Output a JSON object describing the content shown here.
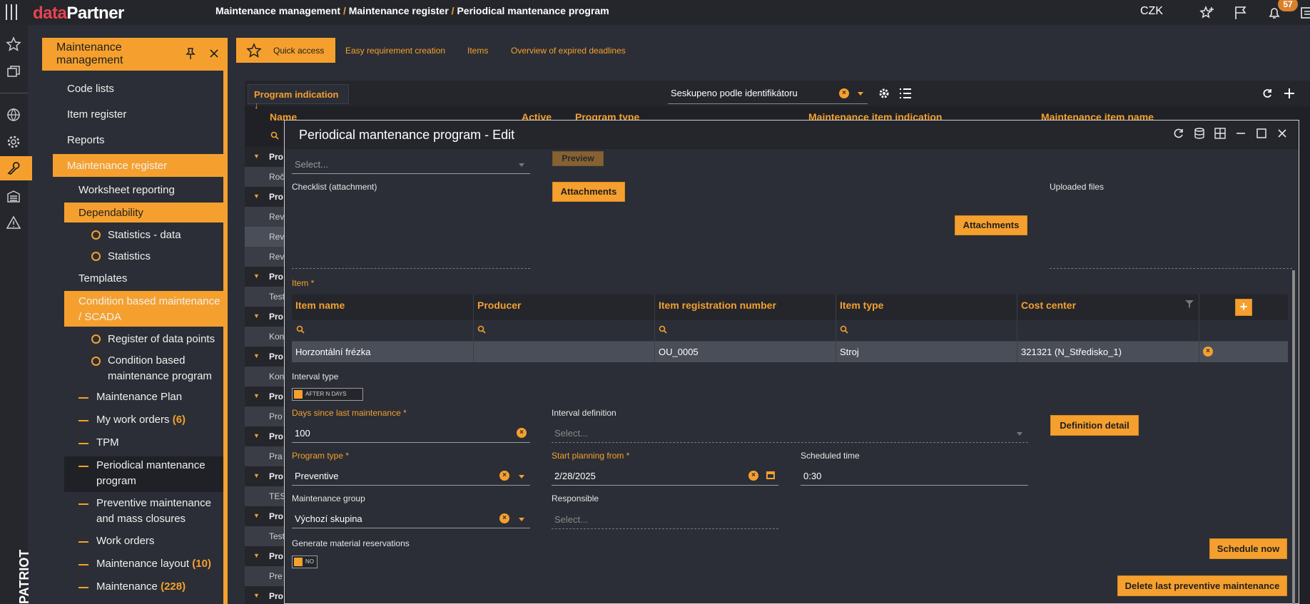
{
  "app": {
    "brand_a": "data",
    "brand_b": "Partner",
    "currency": "CZK",
    "notifications": "57",
    "breadcrumb": [
      "Maintenance management",
      "Maintenance register",
      "Periodical mantenance program"
    ],
    "vertical_brand": "PATRIOT"
  },
  "nav": {
    "title": "Maintenance management",
    "items": [
      {
        "label": "Code lists"
      },
      {
        "label": "Item register"
      },
      {
        "label": "Reports"
      },
      {
        "label": "Maintenance register"
      },
      {
        "label": "Worksheet reporting"
      },
      {
        "label": "Dependability"
      },
      {
        "label": "Statistics - data"
      },
      {
        "label": "Statistics"
      },
      {
        "label": "Templates"
      },
      {
        "label_1": "Condition based maintenance",
        "label_2": "/ SCADA"
      },
      {
        "label": "Register of data points"
      },
      {
        "label_1": "Condition based",
        "label_2": "maintenance program"
      },
      {
        "label": "Maintenance Plan"
      },
      {
        "label": "My work orders",
        "count": "(6)"
      },
      {
        "label": "TPM"
      },
      {
        "label_1": "Periodical mantenance",
        "label_2": "program"
      },
      {
        "label_1": "Preventive maintenance",
        "label_2": "and mass closures"
      },
      {
        "label": "Work orders"
      },
      {
        "label": "Maintenance layout",
        "count": "(10)"
      },
      {
        "label": "Maintenance",
        "count": "(228)"
      }
    ]
  },
  "tabs": [
    "Quick access",
    "Easy requirement creation",
    "Items",
    "Overview of expired deadlines"
  ],
  "grid": {
    "group_button": "Program indication",
    "group_select": "Seskupeno podle identifikátoru",
    "columns": [
      "Name",
      "Active",
      "Program type",
      "Maintenance item indication",
      "Maintenance item name"
    ],
    "rows": [
      "Pro",
      "Roč",
      "Pro",
      "Rev",
      "Rev",
      "Rev",
      "Pro",
      "Test",
      "Pro",
      "Kon",
      "Pro",
      "Kon",
      "Pro",
      "Pro",
      "Pro",
      "Pra",
      "Pro",
      "TES",
      "Pro",
      "Test",
      "Pro",
      "Pre",
      "Pro"
    ]
  },
  "modal": {
    "title": "Periodical mantenance program - Edit",
    "select_placeholder": "Select...",
    "preview_button": "Preview",
    "checklist_label": "Checklist (attachment)",
    "attachments_button": "Attachments",
    "uploaded_files_label": "Uploaded files",
    "item_label": "Item *",
    "item_table": {
      "columns": [
        "Item name",
        "Producer",
        "Item registration number",
        "Item type",
        "Cost center"
      ],
      "row": [
        "Horzontální frézka",
        "",
        "OU_0005",
        "Stroj",
        "321321 (N_Středisko_1)"
      ]
    },
    "interval_type_label": "Interval type",
    "interval_type_value": "AFTER N DAYS",
    "days_label": "Days since last maintenance *",
    "days_value": "100",
    "interval_def_label": "Interval definition",
    "interval_def_placeholder": "Select...",
    "definition_detail_button": "Definition detail",
    "program_type_label": "Program type *",
    "program_type_value": "Preventive",
    "start_planning_label": "Start planning from *",
    "start_planning_value": "2/28/2025",
    "scheduled_time_label": "Scheduled time",
    "scheduled_time_value": "0:30",
    "group_label": "Maintenance group",
    "group_value": "Výchozí skupina",
    "responsible_label": "Responsible",
    "responsible_placeholder": "Select...",
    "gen_material_label": "Generate material reservations",
    "gen_material_value": "NO",
    "schedule_now_button": "Schedule now",
    "delete_last_button": "Delete last preventive maintenance"
  },
  "colors": {
    "accent": "#f5a02e",
    "background": "#2b2e36",
    "brand_red": "#e8434f"
  }
}
